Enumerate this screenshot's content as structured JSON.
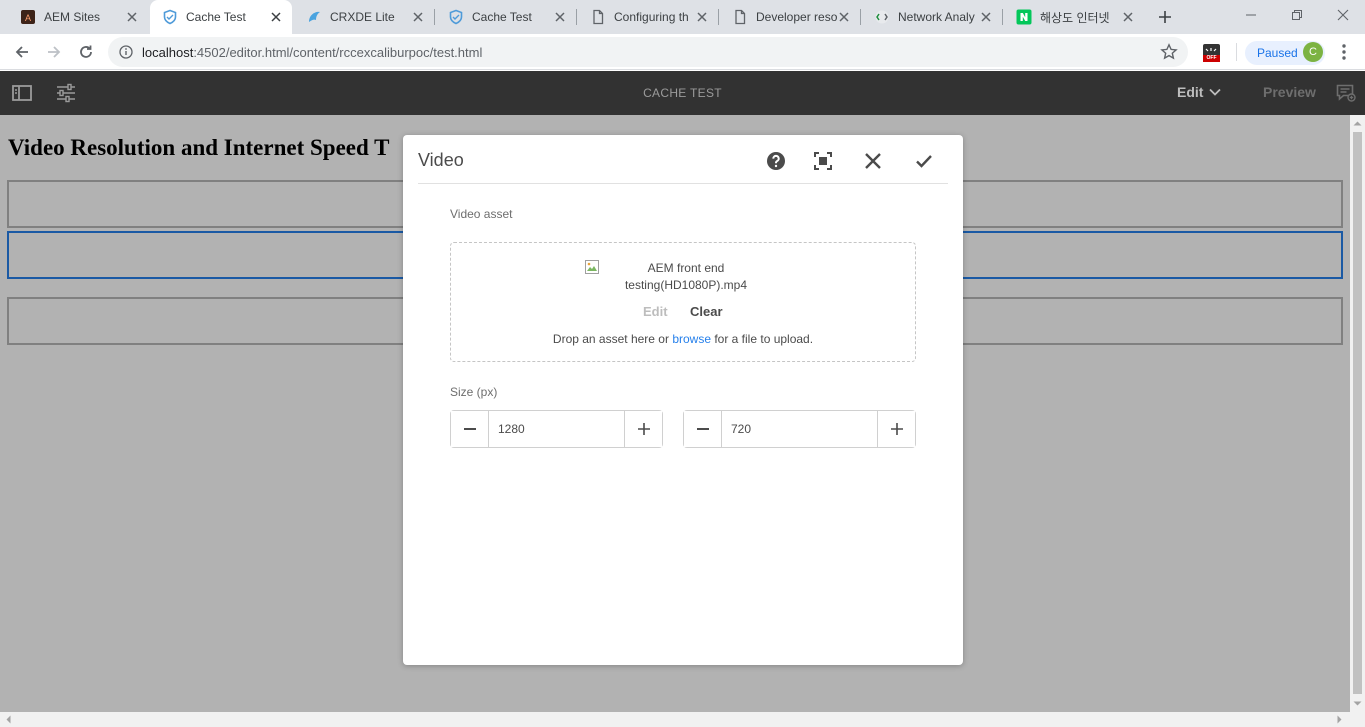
{
  "browser": {
    "tabs": [
      {
        "title": "AEM Sites",
        "icon": "aem-icon",
        "active": false
      },
      {
        "title": "Cache Test",
        "icon": "shield-icon",
        "active": true
      },
      {
        "title": "CRXDE Lite",
        "icon": "crxde-icon",
        "active": false
      },
      {
        "title": "Cache Test",
        "icon": "shield-icon",
        "active": false
      },
      {
        "title": "Configuring th",
        "icon": "document-icon",
        "active": false
      },
      {
        "title": "Developer reso",
        "icon": "document-icon",
        "active": false
      },
      {
        "title": "Network Analy",
        "icon": "network-icon",
        "active": false
      },
      {
        "title": "해상도 인터넷",
        "icon": "naver-icon",
        "active": false
      }
    ],
    "url_host": "localhost",
    "url_rest": ":4502/editor.html/content/rccexcaliburpoc/test.html",
    "profile_status": "Paused",
    "profile_initial": "C",
    "extension_badge": "OFF"
  },
  "editor": {
    "page_title": "CACHE TEST",
    "mode_label": "Edit",
    "preview_label": "Preview"
  },
  "page": {
    "heading": "Video Resolution and Internet Speed T"
  },
  "dialog": {
    "title": "Video",
    "video_asset_label": "Video asset",
    "asset_name": "AEM front end testing(HD1080P).mp4",
    "edit_label": "Edit",
    "clear_label": "Clear",
    "drop_text_before": "Drop an asset here or ",
    "browse_label": "browse",
    "drop_text_after": " for a file to upload.",
    "size_label": "Size (px)",
    "width_value": "1280",
    "height_value": "720"
  },
  "colors": {
    "accent": "#2680eb",
    "editor_bar": "#323232",
    "naver_green": "#03c75a"
  }
}
